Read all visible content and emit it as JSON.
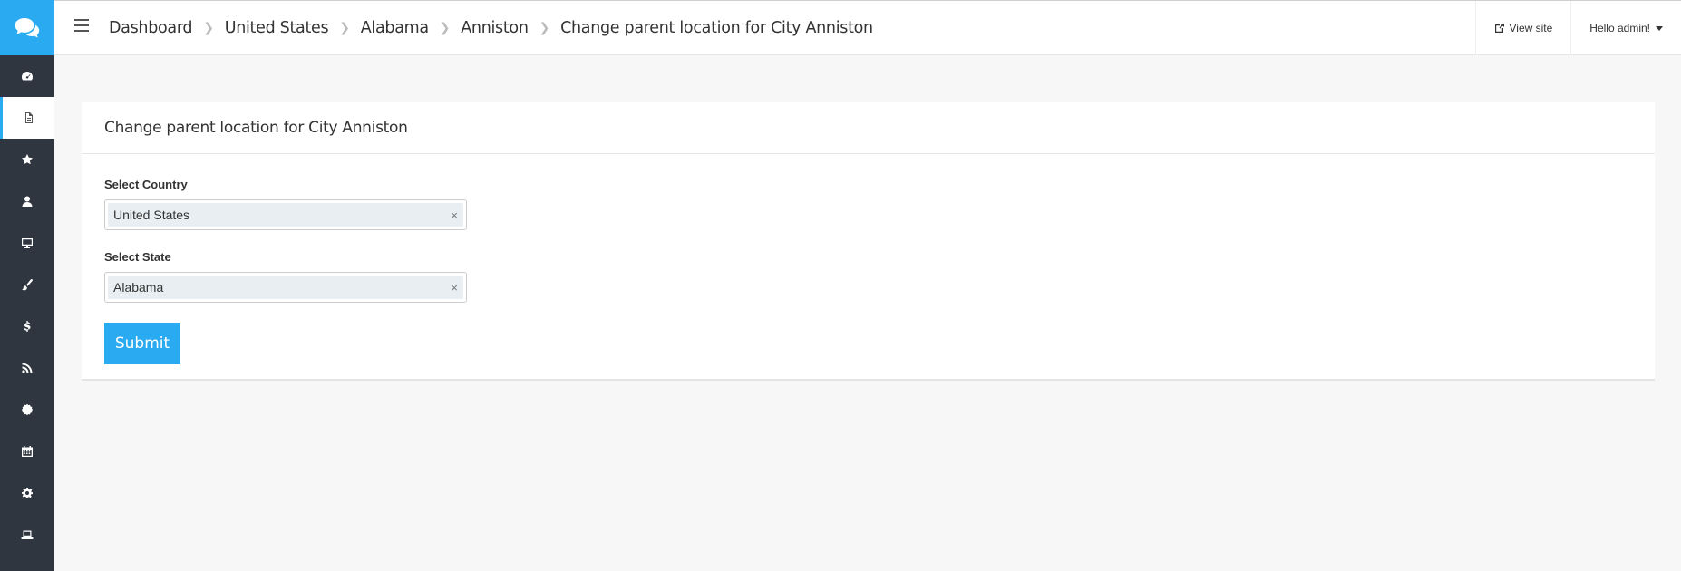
{
  "breadcrumb": {
    "items": [
      "Dashboard",
      "United States",
      "Alabama",
      "Anniston",
      "Change parent location for City Anniston"
    ]
  },
  "topbar": {
    "view_site": "View site",
    "hello": "Hello admin!"
  },
  "panel": {
    "title": "Change parent location for City Anniston",
    "country_label": "Select Country",
    "country_value": "United States",
    "state_label": "Select State",
    "state_value": "Alabama",
    "clear_symbol": "×",
    "submit_label": "Submit"
  },
  "sidebar": {
    "items": [
      "dashboard-icon",
      "file-icon",
      "star-icon",
      "user-icon",
      "desktop-icon",
      "brush-icon",
      "dollar-icon",
      "rss-icon",
      "certificate-icon",
      "calendar-icon",
      "gear-icon",
      "laptop-icon"
    ],
    "active_index": 1
  },
  "colors": {
    "accent": "#2aaaf0",
    "sidebar": "#2f3640",
    "background": "#f7f7f7"
  }
}
